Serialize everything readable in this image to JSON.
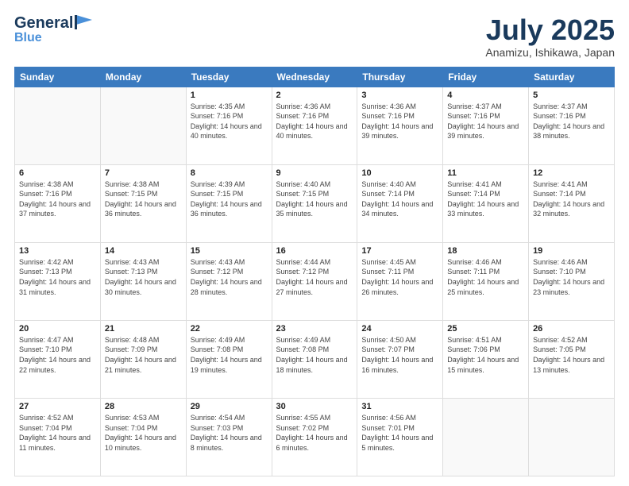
{
  "header": {
    "logo_general": "General",
    "logo_blue": "Blue",
    "month_title": "July 2025",
    "location": "Anamizu, Ishikawa, Japan"
  },
  "weekdays": [
    "Sunday",
    "Monday",
    "Tuesday",
    "Wednesday",
    "Thursday",
    "Friday",
    "Saturday"
  ],
  "weeks": [
    [
      {
        "day": "",
        "empty": true
      },
      {
        "day": "",
        "empty": true
      },
      {
        "day": "1",
        "sunrise": "4:35 AM",
        "sunset": "7:16 PM",
        "daylight": "14 hours and 40 minutes."
      },
      {
        "day": "2",
        "sunrise": "4:36 AM",
        "sunset": "7:16 PM",
        "daylight": "14 hours and 40 minutes."
      },
      {
        "day": "3",
        "sunrise": "4:36 AM",
        "sunset": "7:16 PM",
        "daylight": "14 hours and 39 minutes."
      },
      {
        "day": "4",
        "sunrise": "4:37 AM",
        "sunset": "7:16 PM",
        "daylight": "14 hours and 39 minutes."
      },
      {
        "day": "5",
        "sunrise": "4:37 AM",
        "sunset": "7:16 PM",
        "daylight": "14 hours and 38 minutes."
      }
    ],
    [
      {
        "day": "6",
        "sunrise": "4:38 AM",
        "sunset": "7:16 PM",
        "daylight": "14 hours and 37 minutes."
      },
      {
        "day": "7",
        "sunrise": "4:38 AM",
        "sunset": "7:15 PM",
        "daylight": "14 hours and 36 minutes."
      },
      {
        "day": "8",
        "sunrise": "4:39 AM",
        "sunset": "7:15 PM",
        "daylight": "14 hours and 36 minutes."
      },
      {
        "day": "9",
        "sunrise": "4:40 AM",
        "sunset": "7:15 PM",
        "daylight": "14 hours and 35 minutes."
      },
      {
        "day": "10",
        "sunrise": "4:40 AM",
        "sunset": "7:14 PM",
        "daylight": "14 hours and 34 minutes."
      },
      {
        "day": "11",
        "sunrise": "4:41 AM",
        "sunset": "7:14 PM",
        "daylight": "14 hours and 33 minutes."
      },
      {
        "day": "12",
        "sunrise": "4:41 AM",
        "sunset": "7:14 PM",
        "daylight": "14 hours and 32 minutes."
      }
    ],
    [
      {
        "day": "13",
        "sunrise": "4:42 AM",
        "sunset": "7:13 PM",
        "daylight": "14 hours and 31 minutes."
      },
      {
        "day": "14",
        "sunrise": "4:43 AM",
        "sunset": "7:13 PM",
        "daylight": "14 hours and 30 minutes."
      },
      {
        "day": "15",
        "sunrise": "4:43 AM",
        "sunset": "7:12 PM",
        "daylight": "14 hours and 28 minutes."
      },
      {
        "day": "16",
        "sunrise": "4:44 AM",
        "sunset": "7:12 PM",
        "daylight": "14 hours and 27 minutes."
      },
      {
        "day": "17",
        "sunrise": "4:45 AM",
        "sunset": "7:11 PM",
        "daylight": "14 hours and 26 minutes."
      },
      {
        "day": "18",
        "sunrise": "4:46 AM",
        "sunset": "7:11 PM",
        "daylight": "14 hours and 25 minutes."
      },
      {
        "day": "19",
        "sunrise": "4:46 AM",
        "sunset": "7:10 PM",
        "daylight": "14 hours and 23 minutes."
      }
    ],
    [
      {
        "day": "20",
        "sunrise": "4:47 AM",
        "sunset": "7:10 PM",
        "daylight": "14 hours and 22 minutes."
      },
      {
        "day": "21",
        "sunrise": "4:48 AM",
        "sunset": "7:09 PM",
        "daylight": "14 hours and 21 minutes."
      },
      {
        "day": "22",
        "sunrise": "4:49 AM",
        "sunset": "7:08 PM",
        "daylight": "14 hours and 19 minutes."
      },
      {
        "day": "23",
        "sunrise": "4:49 AM",
        "sunset": "7:08 PM",
        "daylight": "14 hours and 18 minutes."
      },
      {
        "day": "24",
        "sunrise": "4:50 AM",
        "sunset": "7:07 PM",
        "daylight": "14 hours and 16 minutes."
      },
      {
        "day": "25",
        "sunrise": "4:51 AM",
        "sunset": "7:06 PM",
        "daylight": "14 hours and 15 minutes."
      },
      {
        "day": "26",
        "sunrise": "4:52 AM",
        "sunset": "7:05 PM",
        "daylight": "14 hours and 13 minutes."
      }
    ],
    [
      {
        "day": "27",
        "sunrise": "4:52 AM",
        "sunset": "7:04 PM",
        "daylight": "14 hours and 11 minutes."
      },
      {
        "day": "28",
        "sunrise": "4:53 AM",
        "sunset": "7:04 PM",
        "daylight": "14 hours and 10 minutes."
      },
      {
        "day": "29",
        "sunrise": "4:54 AM",
        "sunset": "7:03 PM",
        "daylight": "14 hours and 8 minutes."
      },
      {
        "day": "30",
        "sunrise": "4:55 AM",
        "sunset": "7:02 PM",
        "daylight": "14 hours and 6 minutes."
      },
      {
        "day": "31",
        "sunrise": "4:56 AM",
        "sunset": "7:01 PM",
        "daylight": "14 hours and 5 minutes."
      },
      {
        "day": "",
        "empty": true
      },
      {
        "day": "",
        "empty": true
      }
    ]
  ]
}
